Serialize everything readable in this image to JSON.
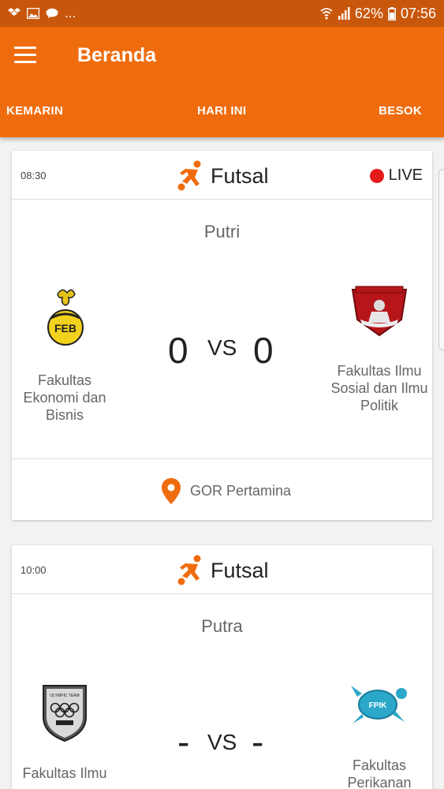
{
  "status_bar": {
    "more": "...",
    "battery": "62%",
    "time": "07:56"
  },
  "app_bar": {
    "title": "Beranda",
    "tabs": [
      "KEMARIN",
      "HARI INI",
      "BESOK"
    ]
  },
  "matches": [
    {
      "time": "08:30",
      "sport": "Futsal",
      "live_label": "LIVE",
      "category": "Putri",
      "home_team": {
        "name": "Fakultas Ekonomi dan Bisnis",
        "logo_text": "FEB"
      },
      "away_team": {
        "name": "Fakultas Ilmu Sosial dan Ilmu Politik"
      },
      "home_score": "0",
      "vs": "VS",
      "away_score": "0",
      "venue": "GOR Pertamina"
    },
    {
      "time": "10:00",
      "sport": "Futsal",
      "category": "Putra",
      "home_team": {
        "name": "Fakultas Ilmu",
        "logo_text": "OLYMPIC TEAM"
      },
      "away_team": {
        "name": "Fakultas Perikanan",
        "logo_text": "FPIK"
      },
      "home_score": "-",
      "vs": "VS",
      "away_score": "-"
    }
  ],
  "colors": {
    "primary": "#ef6c0e",
    "status_bar": "#c9570b",
    "live": "#e51b1b"
  }
}
